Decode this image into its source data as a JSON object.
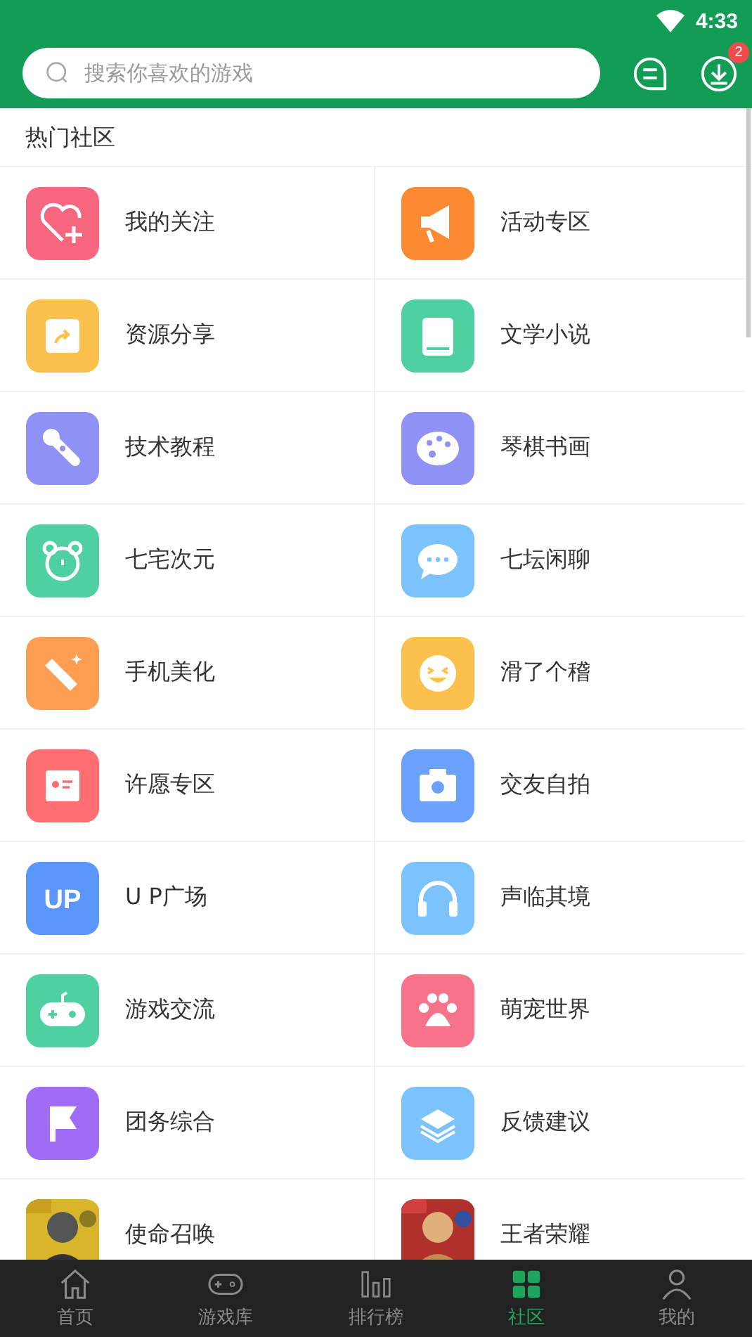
{
  "status_bar": {
    "time": "4:33"
  },
  "search": {
    "placeholder": "搜索你喜欢的游戏"
  },
  "download_badge": "2",
  "section_title": "热门社区",
  "communities": [
    {
      "label": "我的关注",
      "color": "#f7667f"
    },
    {
      "label": "活动专区",
      "color": "#fc8a33"
    },
    {
      "label": "资源分享",
      "color": "#fcc04c"
    },
    {
      "label": "文学小说",
      "color": "#4fd0a0"
    },
    {
      "label": "技术教程",
      "color": "#8f91f5"
    },
    {
      "label": "琴棋书画",
      "color": "#8f91f5"
    },
    {
      "label": "七宅次元",
      "color": "#4fd0a0"
    },
    {
      "label": "七坛闲聊",
      "color": "#7cc3fb"
    },
    {
      "label": "手机美化",
      "color": "#fd9e52"
    },
    {
      "label": "滑了个稽",
      "color": "#fcc04c"
    },
    {
      "label": "许愿专区",
      "color": "#fd6e70"
    },
    {
      "label": "交友自拍",
      "color": "#6aa1fc"
    },
    {
      "label": "U P广场",
      "color": "#5b96fb",
      "icon_text": "UP"
    },
    {
      "label": "声临其境",
      "color": "#7cc3fb"
    },
    {
      "label": "游戏交流",
      "color": "#4fd0a0"
    },
    {
      "label": "萌宠世界",
      "color": "#f7738a"
    },
    {
      "label": "团务综合",
      "color": "#a06cf5"
    },
    {
      "label": "反馈建议",
      "color": "#7cc3fb"
    },
    {
      "label": "使命召唤",
      "kind": "picture"
    },
    {
      "label": "王者荣耀",
      "kind": "picture"
    }
  ],
  "bottom_nav": [
    {
      "label": "首页",
      "selected": false
    },
    {
      "label": "游戏库",
      "selected": false
    },
    {
      "label": "排行榜",
      "selected": false
    },
    {
      "label": "社区",
      "selected": true
    },
    {
      "label": "我的",
      "selected": false
    }
  ]
}
